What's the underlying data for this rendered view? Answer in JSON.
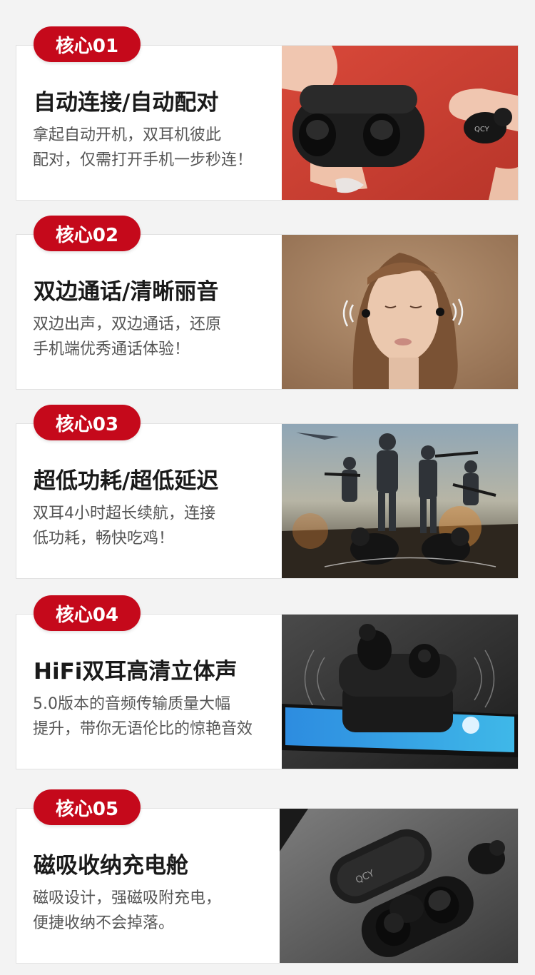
{
  "features": [
    {
      "badge": "核心01",
      "title": "自动连接/自动配对",
      "desc_line1": "拿起自动开机，双耳机彼此",
      "desc_line2": "配对，仅需打开手机一步秒连！",
      "image_alt": "charging-case-with-earbuds-red-background"
    },
    {
      "badge": "核心02",
      "title": "双边通话/清晰丽音",
      "desc_line1": "双边出声，双边通话，还原",
      "desc_line2": "手机端优秀通话体验！",
      "image_alt": "woman-wearing-earbuds"
    },
    {
      "badge": "核心03",
      "title": "超低功耗/超低延迟",
      "desc_line1": "双耳4小时超长续航，连接",
      "desc_line2": "低功耗，畅快吃鸡！",
      "image_alt": "game-characters-with-earbuds"
    },
    {
      "badge": "核心04",
      "title": "HiFi双耳高清立体声",
      "desc_line1": "5.0版本的音频传输质量大幅",
      "desc_line2": "提升，带你无语伦比的惊艳音效",
      "image_alt": "phone-with-earbuds-case"
    },
    {
      "badge": "核心05",
      "title": "磁吸收纳充电舱",
      "desc_line1": "磁吸设计，强磁吸附充电，",
      "desc_line2": "便捷收纳不会掉落。",
      "image_alt": "open-charging-case-dark"
    }
  ],
  "brand_mark": "QCY",
  "colors": {
    "badge": "#c5091b",
    "page_bg": "#f3f3f3",
    "card_bg": "#ffffff"
  }
}
